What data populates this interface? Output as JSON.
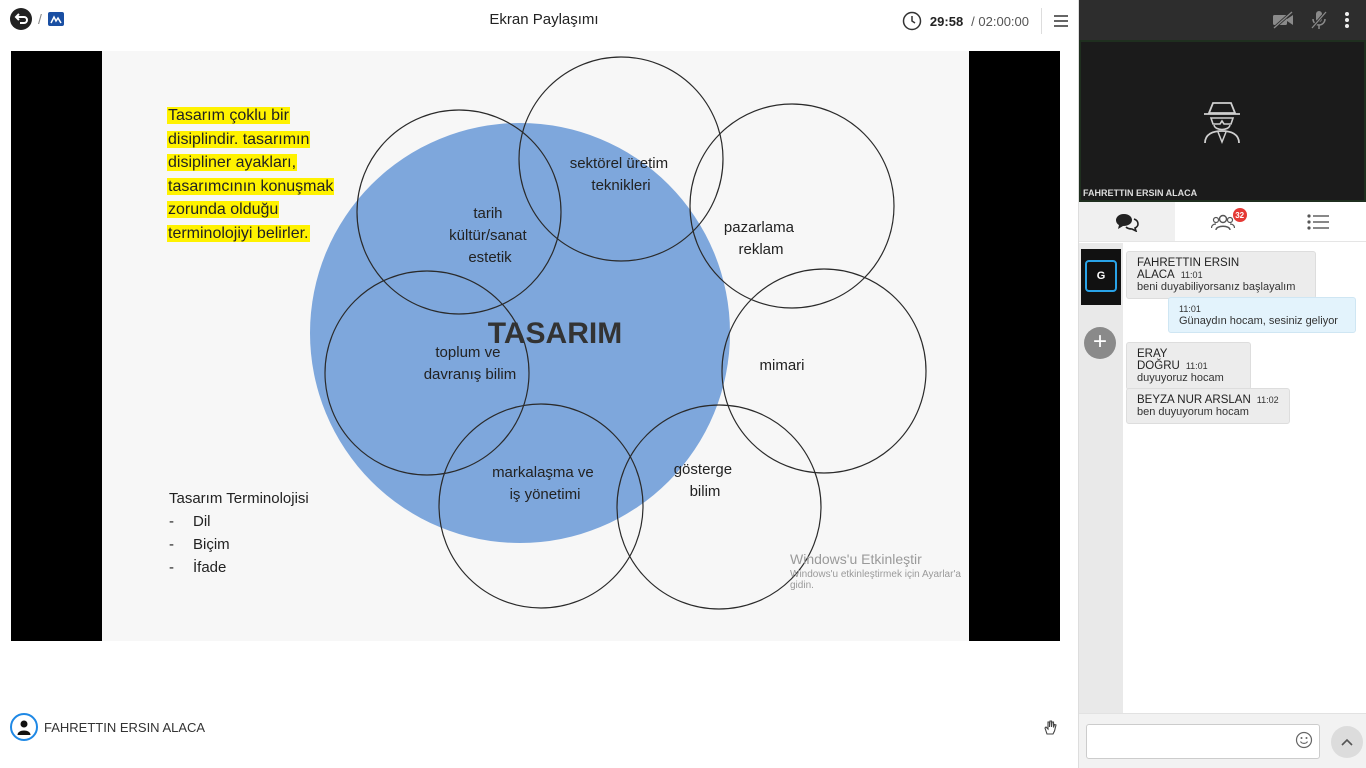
{
  "topbar": {
    "title": "Ekran Paylaşımı",
    "timer_elapsed": "29:58",
    "timer_total": "/ 02:00:00"
  },
  "slide": {
    "note_lines": [
      "Tasarım çoklu bir",
      "disiplindir. tasarımın",
      "disipliner ayakları,",
      "tasarımcının konuşmak",
      "zorunda olduğu",
      "terminolojiyi belirler."
    ],
    "center_label": "TASARIM",
    "circles": [
      {
        "lines": [
          "sektörel üretim",
          "teknikleri"
        ]
      },
      {
        "lines": [
          "pazarlama",
          "reklam"
        ]
      },
      {
        "lines": [
          "mimari"
        ]
      },
      {
        "lines": [
          "gösterge",
          "bilim"
        ]
      },
      {
        "lines": [
          "markalaşma ve",
          "iş yönetimi"
        ]
      },
      {
        "lines": [
          "toplum ve",
          "davranış bilim"
        ]
      },
      {
        "lines": [
          "tarih",
          "kültür/sanat",
          "estetik"
        ]
      }
    ],
    "terms_title": "Tasarım Terminolojisi",
    "terms": [
      "Dil",
      "Biçim",
      "İfade"
    ],
    "terms_dash": "-",
    "watermark_title": "Windows'u Etkinleştir",
    "watermark_sub": "Windows'u etkinleştirmek için Ayarlar'a gidin.",
    "colors": {
      "center_fill": "#7ea7dc",
      "highlight": "#fff200"
    }
  },
  "presenter": {
    "name": "FAHRETTIN ERSIN ALACA"
  },
  "video": {
    "participant_name": "FAHRETTIN ERSIN ALACA"
  },
  "tabs": {
    "participants_badge": "32"
  },
  "chat": {
    "rail_initial": "G",
    "rail_add": "+",
    "messages": [
      {
        "sender": "FAHRETTIN ERSIN ALACA",
        "time": "11:01",
        "text": "beni duyabiliyorsanız başlayalım"
      },
      {
        "sender": "",
        "time": "11:01",
        "text": "Günaydın hocam, sesiniz geliyor"
      },
      {
        "sender": "ERAY DOĞRU",
        "time": "11:01",
        "text": "duyuyoruz hocam"
      },
      {
        "sender": "BEYZA NUR ARSLAN",
        "time": "11:02",
        "text": "ben duyuyorum hocam"
      }
    ],
    "input_value": ""
  }
}
